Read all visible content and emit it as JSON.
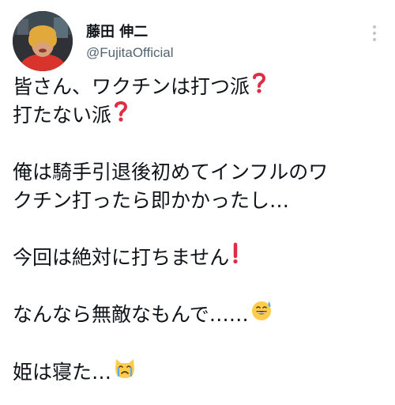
{
  "user": {
    "display_name": "藤田 伸二",
    "handle": "@FujitaOfficial"
  },
  "tweet": {
    "lines": [
      "皆さん、ワクチンは打つ派",
      "打たない派",
      "俺は騎手引退後初めてインフルのワ",
      "クチン打ったら即かかったし…",
      "今回は絶対に打ちません",
      "なんなら無敵なもんで……",
      "姫は寝た…"
    ],
    "emojis": {
      "line1": "red-question-mark",
      "line2": "red-question-mark",
      "line5": "red-exclamation-mark",
      "line6": "grinning-face-with-sweat",
      "line7": "crying-cat-face"
    }
  },
  "colors": {
    "text": "#0f1419",
    "secondary": "#536471",
    "emoji_red": "#dd2e44",
    "emoji_yellow": "#ffcc4d",
    "emoji_sweat": "#5dadec"
  }
}
